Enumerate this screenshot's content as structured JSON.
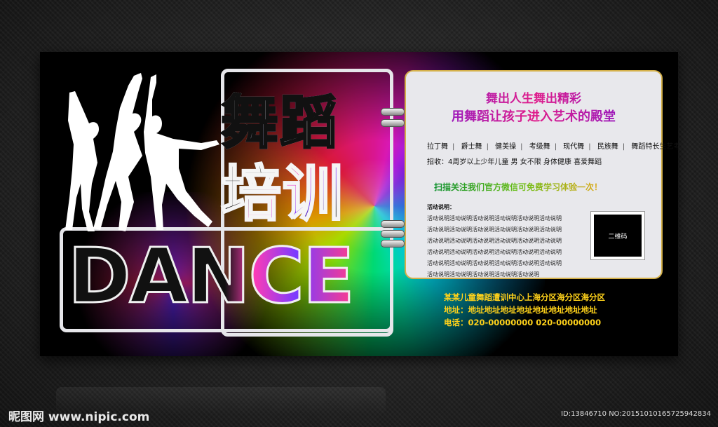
{
  "title_cn_line1": "舞蹈",
  "title_cn_line2": "培训",
  "title_en": "DANCE",
  "slogan": {
    "line1": "舞出人生舞出精彩",
    "line2": "用舞蹈让孩子进入艺术的殿堂"
  },
  "dance_types": [
    "拉丁舞",
    "爵士舞",
    "健美操",
    "考级舞",
    "现代舞",
    "民族舞",
    "舞蹈特长生艺考"
  ],
  "recruit": "招收：4周岁以上少年儿童   男   女不限   身体健康   喜爱舞蹈",
  "scan_text": "扫描关注我们官方微信可免费学习体验一次！",
  "activity": {
    "title": "活动说明：",
    "lines": [
      "活动说明活动说明活动说明活动说明活动说明活动说明",
      "活动说明活动说明活动说明活动说明活动说明活动说明",
      "活动说明活动说明活动说明活动说明活动说明活动说明",
      "活动说明活动说明活动说明活动说明活动说明活动说明",
      "活动说明活动说明活动说明活动说明活动说明活动说明",
      "活动说明活动说明活动说明活动说明活动说明"
    ]
  },
  "qr_label": "二维码",
  "contact": {
    "org": "某某儿童舞蹈遭训中心上海分区海分区海分区",
    "address": "地址：地址地址地址地址地址地址地址地址",
    "phone": "电话：020-00000000  020-00000000"
  },
  "watermark": "昵图网 www.nipic.com",
  "photo_id": "ID:13846710 NO:20151010165725942834",
  "colors": {
    "slogan": "#c81b9a",
    "scan": "#2a9f1a",
    "contact": "#ffd21a",
    "frame_border": "#d4b04a"
  }
}
